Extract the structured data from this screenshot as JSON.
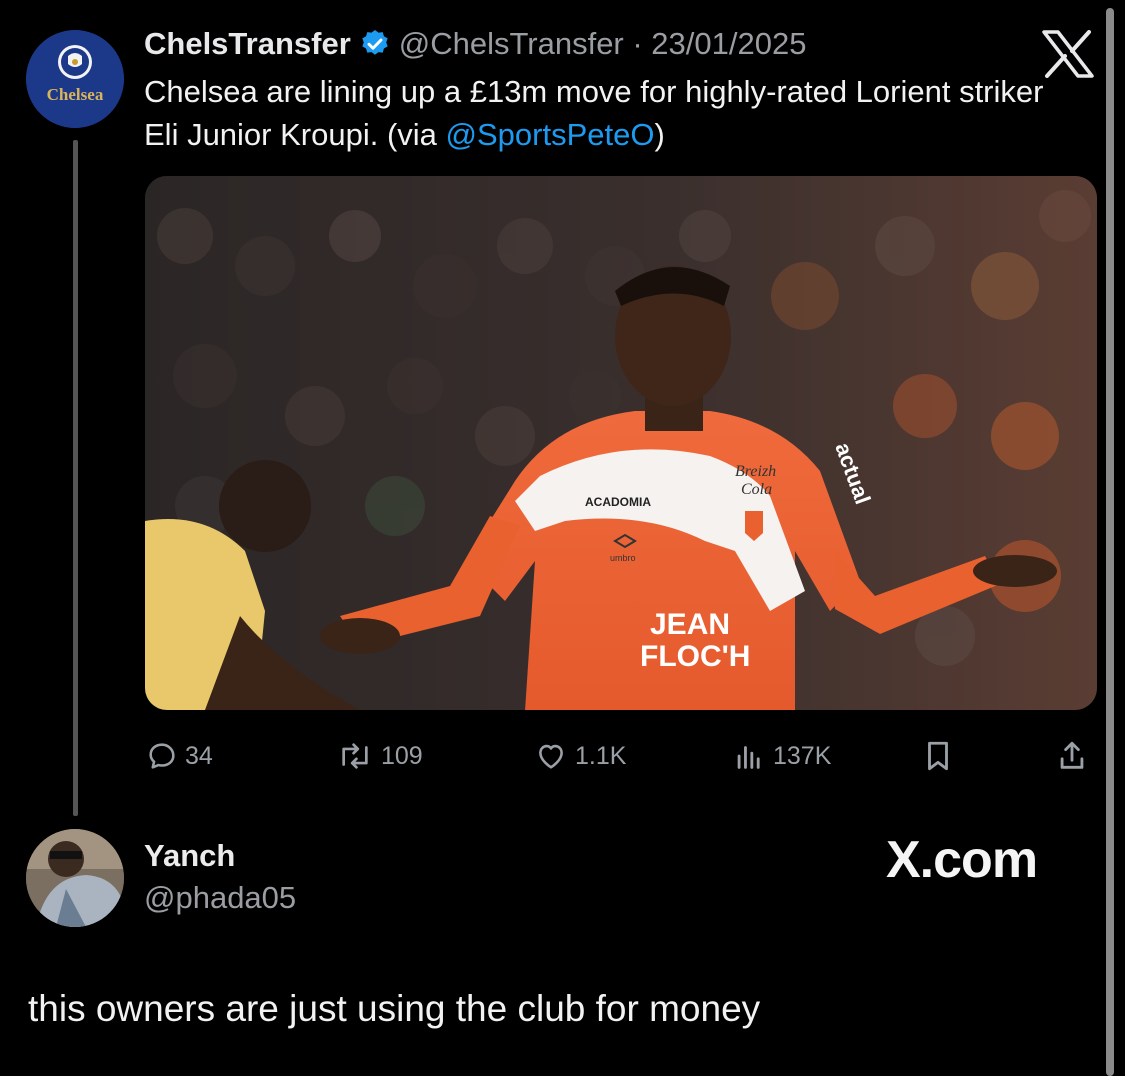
{
  "quoted_tweet": {
    "author_name": "ChelsTransfer",
    "handle_and_date": "@ChelsTransfer · 23/01/2025",
    "avatar_text": "Chelsea",
    "text_part1": "Chelsea are lining up a £13m move for highly-rated Lorient striker Eli Junior Kroupi. (via ",
    "mention": "@SportsPeteO",
    "text_part2": ")",
    "media": {
      "sponsor_left": "ACADOMIA",
      "sponsor_right_line1": "Breizh",
      "sponsor_right_line2": "Cola",
      "kit_brand": "umbro",
      "sleeve_sponsor": "actual",
      "main_sponsor_line1": "JEAN",
      "main_sponsor_line2": "FLOC'H"
    },
    "actions": {
      "replies": "34",
      "reposts": "109",
      "likes": "1.1K",
      "views": "137K"
    }
  },
  "reply": {
    "author_name": "Yanch",
    "handle": "@phada05",
    "watermark": "X.com",
    "text": "this owners are just using the club for money"
  },
  "colors": {
    "background": "#000000",
    "link": "#1d9bf0",
    "muted": "#9a9ea2",
    "verified": "#1d9bf0"
  }
}
